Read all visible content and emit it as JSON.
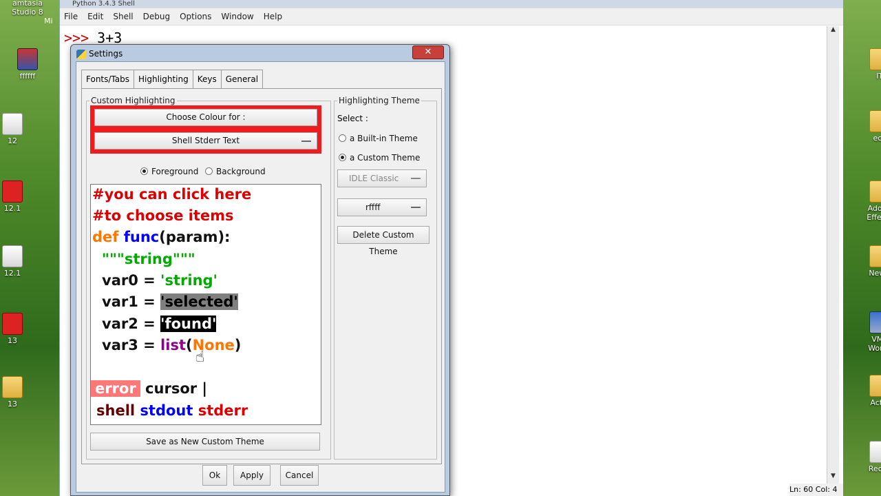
{
  "desktop": {
    "left_icons": [
      {
        "label": "amtasia\nStudio 8",
        "kind": "blue"
      },
      {
        "label": "ffffff",
        "kind": "rar"
      },
      {
        "label": "12",
        "kind": "doc"
      },
      {
        "label": "12.1",
        "kind": "red"
      },
      {
        "label": "12.1",
        "kind": "doc"
      },
      {
        "label": "13",
        "kind": "red"
      },
      {
        "label": "13",
        "kind": "folder"
      }
    ],
    "left_partial": "Mi",
    "right_icons": [
      {
        "label": "IT",
        "kind": "folder"
      },
      {
        "label": "ecli",
        "kind": "folder"
      },
      {
        "label": "Adobe\nEffects",
        "kind": "folder"
      },
      {
        "label": "New f",
        "kind": "folder"
      },
      {
        "label": "VMv\nWorks",
        "kind": "blue"
      },
      {
        "label": "Activ",
        "kind": "folder"
      },
      {
        "label": "Recyc",
        "kind": "doc"
      }
    ]
  },
  "shell": {
    "title": "Python 3.4.3 Shell",
    "menu": [
      "File",
      "Edit",
      "Shell",
      "Debug",
      "Options",
      "Window",
      "Help"
    ],
    "first_line_prompt": ">>>",
    "first_line_code": " 3+3",
    "status": "Ln: 60  Col: 4"
  },
  "dialog": {
    "title": "Settings",
    "close_label": "✕",
    "tabs": [
      "Fonts/Tabs",
      "Highlighting",
      "Keys",
      "General"
    ],
    "custom_group_label": "Custom Highlighting",
    "choose_colour_label": "Choose Colour for :",
    "element_select": "Shell Stderr Text",
    "fg_label": "Foreground",
    "bg_label": "Background",
    "sample": {
      "comment1": "#you can click here",
      "comment2": "#to choose items",
      "def_kw": "def",
      "func_name": "func",
      "params": "(param):",
      "docstring": "\"\"\"string\"\"\"",
      "var0": "var0 = ",
      "var0_val": "'string'",
      "var1": "var1 = ",
      "var1_val": "'selected'",
      "var2": "var2 = ",
      "var2_val": "'found'",
      "var3": "var3 = ",
      "var3_builtin": "list",
      "var3_open": "(",
      "var3_kw": "None",
      "var3_close": ")",
      "error": "error",
      "cursor": " cursor |",
      "shell": "shell",
      "stdout": "stdout",
      "stderr": "stderr"
    },
    "save_theme_label": "Save as New Custom Theme",
    "theme_group_label": "Highlighting Theme",
    "select_label": "Select :",
    "builtin_label": "a Built-in Theme",
    "custom_label": "a Custom Theme",
    "builtin_value": "IDLE Classic",
    "custom_value": "rffff",
    "delete_label": "Delete Custom Theme",
    "ok_label": "Ok",
    "apply_label": "Apply",
    "cancel_label": "Cancel"
  },
  "colors": {
    "highlight_frame": "#ee1c1c",
    "dialog_frame": "#b8cbe0"
  }
}
